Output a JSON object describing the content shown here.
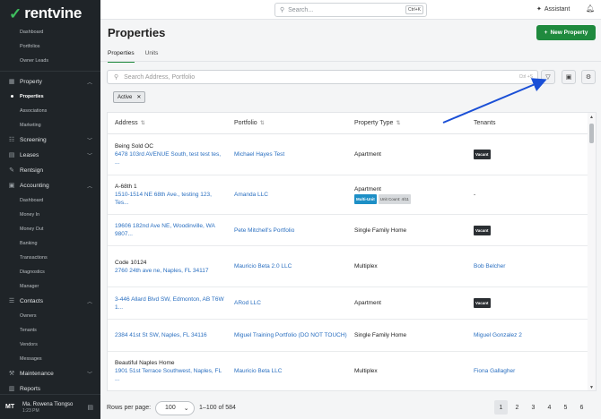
{
  "brand": {
    "name": "rentvine",
    "mark": "✓"
  },
  "nav": {
    "top_items": [
      "Dashboard",
      "Portfolios",
      "Owner Leads"
    ],
    "property": {
      "label": "Property",
      "items": [
        "Properties",
        "Associations",
        "Marketing"
      ]
    },
    "screening": {
      "label": "Screening"
    },
    "leases": {
      "label": "Leases"
    },
    "rentsign": {
      "label": "Rentsign"
    },
    "accounting": {
      "label": "Accounting",
      "items": [
        "Dashboard",
        "Money In",
        "Money Out",
        "Banking",
        "Transactions",
        "Diagnostics",
        "Manager"
      ]
    },
    "contacts": {
      "label": "Contacts",
      "items": [
        "Owners",
        "Tenants",
        "Vendors",
        "Messages"
      ]
    },
    "maintenance": {
      "label": "Maintenance"
    },
    "reports": {
      "label": "Reports"
    }
  },
  "user": {
    "initials": "MT",
    "name": "Ma. Rowena Tiongso",
    "time": "1:23 PM"
  },
  "topbar": {
    "search_placeholder": "Search...",
    "search_shortcut": "Ctrl+K",
    "assistant_label": "Assistant"
  },
  "page": {
    "title": "Properties",
    "new_button": "New Property"
  },
  "tabs": [
    {
      "label": "Properties",
      "active": true
    },
    {
      "label": "Units",
      "active": false
    }
  ],
  "filters": {
    "search_placeholder": "Search Address, Portfolio",
    "search_shortcut": "Ctrl +S",
    "chips": [
      "Active"
    ]
  },
  "table": {
    "columns": [
      "Address",
      "Portfolio",
      "Property Type",
      "Tenants"
    ],
    "rows": [
      {
        "name": "Being Sold OC",
        "address": "6478 103rd AVENUE South, test test tes, ...",
        "portfolio": "Michael Hayes Test",
        "type": "Apartment",
        "type_badges": [],
        "tenant": "",
        "tenant_badge": "Vacant"
      },
      {
        "name": "A-68th 1",
        "address": "1510-1514 NE 68th Ave., testing 123, Tes...",
        "portfolio": "Amanda LLC",
        "type": "Apartment",
        "type_badges": [
          "Multi-Unit",
          "Unit Count: 4/11"
        ],
        "tenant": "-",
        "tenant_badge": ""
      },
      {
        "name": "",
        "address": "19606 182nd Ave NE, Woodinville, WA 9807...",
        "portfolio": "Pete Mitchell's Portfolio",
        "type": "Single Family Home",
        "type_badges": [],
        "tenant": "",
        "tenant_badge": "Vacant"
      },
      {
        "name": "Code 10124",
        "address": "2760 24th ave ne, Naples, FL 34117",
        "portfolio": "Mauricio Beta 2.0 LLC",
        "type": "Multiplex",
        "type_badges": [],
        "tenant": "Bob Belcher",
        "tenant_badge": ""
      },
      {
        "name": "",
        "address": "3-446 Allard Blvd SW, Edmonton, AB T6W 1...",
        "portfolio": "ARod LLC",
        "type": "Apartment",
        "type_badges": [],
        "tenant": "",
        "tenant_badge": "Vacant"
      },
      {
        "name": "",
        "address": "2384 41st St SW, Naples, FL 34116",
        "portfolio": "Miguel Training Portfolio (DO NOT TOUCH)",
        "type": "Single Family Home",
        "type_badges": [],
        "tenant": "Miguel Gonzalez 2",
        "tenant_badge": ""
      },
      {
        "name": "Beautiful Naples Home",
        "address": "1901 51st Terrace Southwest, Naples, FL ...",
        "portfolio": "Mauricio Beta LLC",
        "type": "Multiplex",
        "type_badges": [],
        "tenant": "Fiona Gallagher",
        "tenant_badge": ""
      }
    ]
  },
  "footer": {
    "rows_per_page_label": "Rows per page:",
    "rows_per_page": "100",
    "range": "1–100 of 584",
    "pages": [
      "1",
      "2",
      "3",
      "4",
      "5",
      "6"
    ],
    "current_page": "1"
  },
  "colors": {
    "brand_green": "#1f8a3e",
    "link_blue": "#2a6fc0",
    "annotation_arrow": "#1a4fd6",
    "sidebar_bg": "#1f2428"
  }
}
